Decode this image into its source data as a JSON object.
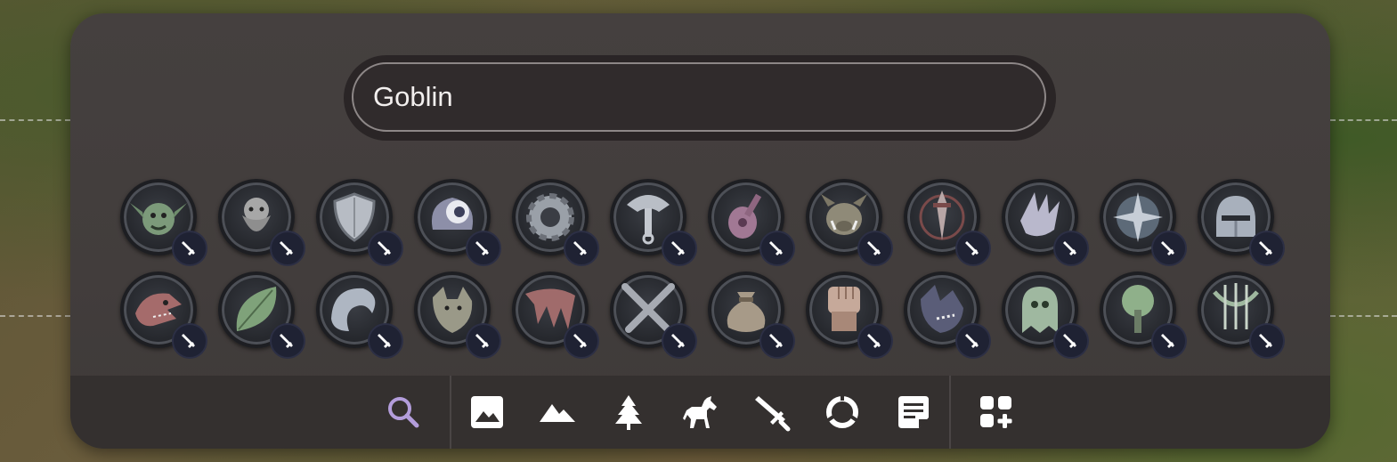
{
  "search": {
    "value": "Goblin"
  },
  "tokens": [
    {
      "name": "goblin",
      "icon": "goblin-token"
    },
    {
      "name": "dwarf",
      "icon": "dwarf-token"
    },
    {
      "name": "shield",
      "icon": "shield-token"
    },
    {
      "name": "eye",
      "icon": "eye-token"
    },
    {
      "name": "gear",
      "icon": "gear-token"
    },
    {
      "name": "grapple",
      "icon": "grapple-token"
    },
    {
      "name": "lute",
      "icon": "lute-token"
    },
    {
      "name": "boar",
      "icon": "boar-token"
    },
    {
      "name": "dagger",
      "icon": "dagger-token"
    },
    {
      "name": "claw",
      "icon": "claw-token"
    },
    {
      "name": "compass",
      "icon": "compass-token"
    },
    {
      "name": "helmet",
      "icon": "helmet-token"
    },
    {
      "name": "dragon",
      "icon": "dragon-token"
    },
    {
      "name": "leaf",
      "icon": "leaf-token"
    },
    {
      "name": "wave",
      "icon": "wave-token"
    },
    {
      "name": "wolf",
      "icon": "wolf-token"
    },
    {
      "name": "wing",
      "icon": "wing-token"
    },
    {
      "name": "crossed-swords",
      "icon": "crossed-swords-token"
    },
    {
      "name": "coin-bag",
      "icon": "coin-bag-token"
    },
    {
      "name": "fist",
      "icon": "fist-token"
    },
    {
      "name": "werewolf",
      "icon": "werewolf-token"
    },
    {
      "name": "ghost",
      "icon": "ghost-token"
    },
    {
      "name": "tree",
      "icon": "tree-token"
    },
    {
      "name": "bow",
      "icon": "bow-token"
    }
  ],
  "toolbar": {
    "active_color": "#b39ddb",
    "icon_color": "#ffffff",
    "tools": [
      "search-icon",
      "image-icon",
      "mountains-icon",
      "tree-icon",
      "horse-icon",
      "sword-icon",
      "ring-icon",
      "note-icon",
      "add-widgets-icon"
    ]
  }
}
